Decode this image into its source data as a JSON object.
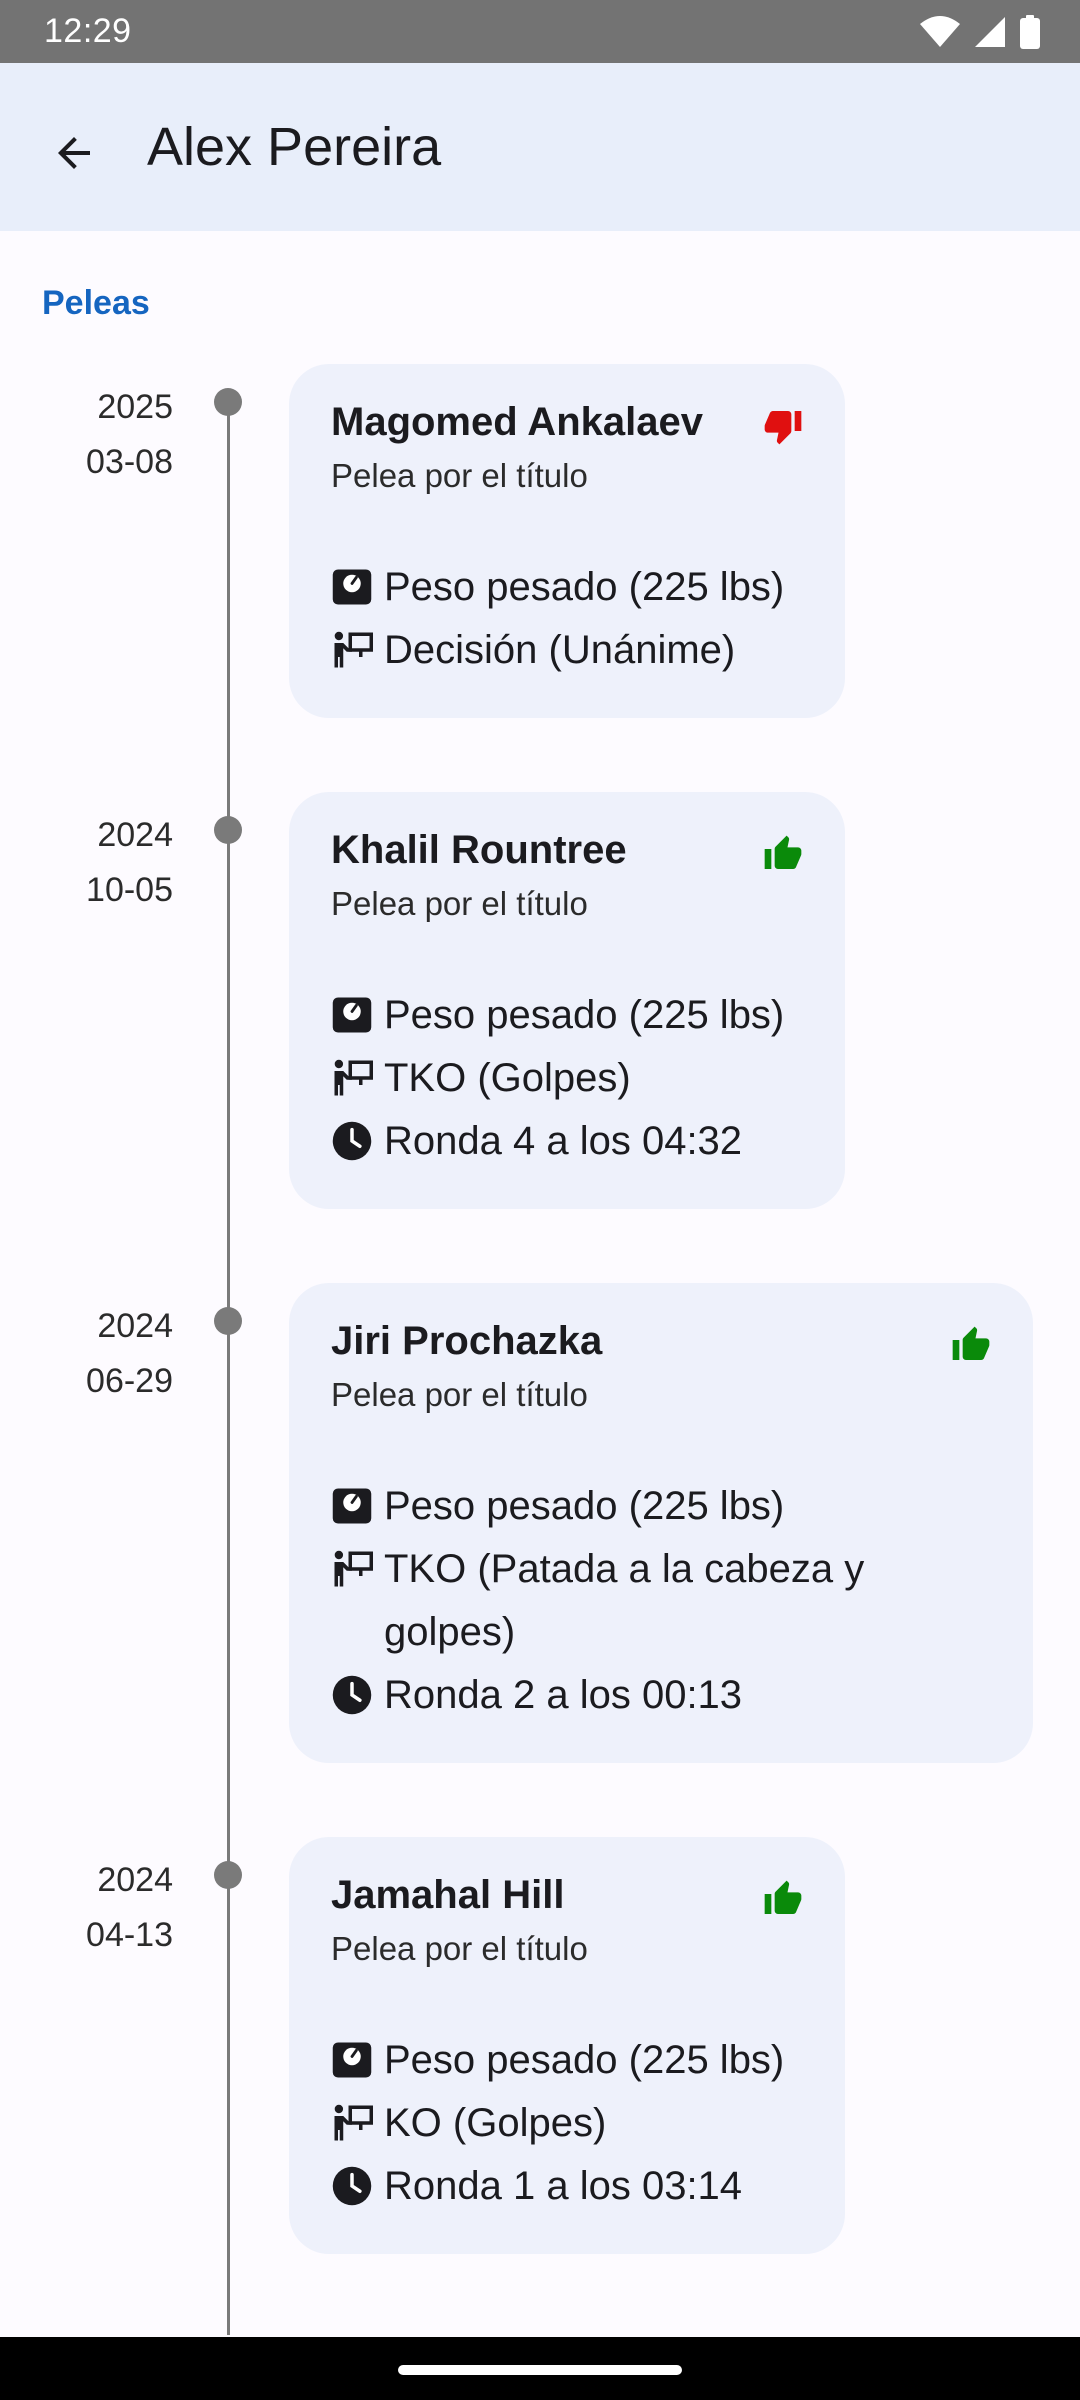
{
  "status_bar": {
    "time": "12:29",
    "icons": [
      "wifi-icon",
      "signal-icon",
      "battery-icon"
    ]
  },
  "app_bar": {
    "back_icon": "arrow-back-icon",
    "title": "Alex Pereira"
  },
  "section": {
    "label": "Peleas"
  },
  "colors": {
    "accent": "#1565c0",
    "win": "#0a8a0a",
    "loss": "#e01010",
    "card": "#eef1fb",
    "app_bar": "#e8eefa"
  },
  "fights": [
    {
      "year": "2025",
      "date": "03-08",
      "opponent": "Magomed Ankalaev",
      "result": "loss",
      "type": "Pelea por el título",
      "weight_class": "Peso pesado (225 lbs)",
      "method": "Decisión (Unánime)",
      "time": ""
    },
    {
      "year": "2024",
      "date": "10-05",
      "opponent": "Khalil Rountree",
      "result": "win",
      "type": "Pelea por el título",
      "weight_class": "Peso pesado (225 lbs)",
      "method": "TKO (Golpes)",
      "time": "Ronda 4 a los 04:32"
    },
    {
      "year": "2024",
      "date": "06-29",
      "opponent": "Jiri Prochazka",
      "result": "win",
      "type": "Pelea por el título",
      "weight_class": "Peso pesado (225 lbs)",
      "method": "TKO (Patada a la cabeza y golpes)",
      "time": "Ronda 2 a los 00:13"
    },
    {
      "year": "2024",
      "date": "04-13",
      "opponent": "Jamahal Hill",
      "result": "win",
      "type": "Pelea por el título",
      "weight_class": "Peso pesado (225 lbs)",
      "method": "KO (Golpes)",
      "time": "Ronda 1 a los 03:14"
    }
  ]
}
